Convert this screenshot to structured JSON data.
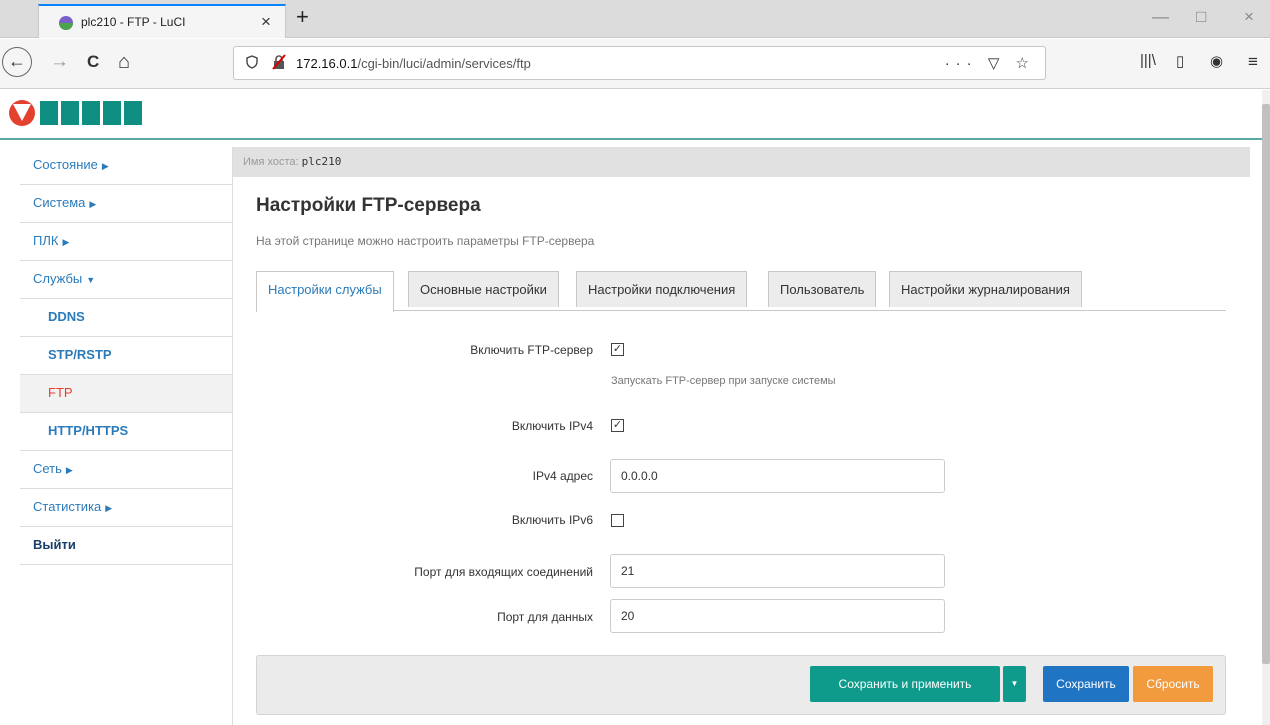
{
  "browser": {
    "tab_title": "plc210 - FTP - LuCI",
    "tab_close": "×",
    "new_tab": "+",
    "url_host": "172.16.0.1",
    "url_path": "/cgi-bin/luci/admin/services/ftp",
    "url_actions": "··· ▽ ☆",
    "icons": {
      "back": "←",
      "forward": "→",
      "reload": "C",
      "home": "⌂",
      "library": "|||\\",
      "sidebar": "▯",
      "account": "◉",
      "menu": "≡",
      "minimize": "—",
      "maximize": "□",
      "close": "×"
    }
  },
  "colors": {
    "accent": "#0e9b8c",
    "link": "#2b7bba",
    "active": "#e4402e",
    "save": "#1f74c4",
    "reset": "#f19a3e",
    "logo_red": "#e4402e",
    "logo_green": "#0e8f82"
  },
  "sidebar": {
    "items": [
      {
        "label": "Состояние",
        "caret": "▶"
      },
      {
        "label": "Система",
        "caret": "▶"
      },
      {
        "label": "ПЛК",
        "caret": "▶"
      },
      {
        "label": "Службы",
        "caret": "▼"
      },
      {
        "label": "DDNS"
      },
      {
        "label": "STP/RSTP"
      },
      {
        "label": "FTP"
      },
      {
        "label": "HTTP/HTTPS"
      },
      {
        "label": "Сеть",
        "caret": "▶"
      },
      {
        "label": "Статистика",
        "caret": "▶"
      },
      {
        "label": "Выйти"
      }
    ]
  },
  "hostbar": {
    "label": "Имя хоста:",
    "value": "plc210"
  },
  "main": {
    "title": "Настройки FTP-сервера",
    "description": "На этой странице можно настроить параметры FTP-сервера",
    "tabs": [
      {
        "label": "Настройки службы"
      },
      {
        "label": "Основные настройки"
      },
      {
        "label": "Настройки подключения"
      },
      {
        "label": "Пользователь"
      },
      {
        "label": "Настройки журналирования"
      }
    ],
    "fields": {
      "enable_ftp": {
        "label": "Включить FTP-сервер",
        "checked": "✓",
        "hint": "Запускать FTP-сервер при запуске системы"
      },
      "enable_ipv4": {
        "label": "Включить IPv4",
        "checked": "✓"
      },
      "ipv4_address": {
        "label": "IPv4 адрес",
        "value": "0.0.0.0"
      },
      "enable_ipv6": {
        "label": "Включить IPv6",
        "checked": ""
      },
      "incoming_port": {
        "label": "Порт для входящих соединений",
        "value": "21"
      },
      "data_port": {
        "label": "Порт для данных",
        "value": "20"
      }
    }
  },
  "actions": {
    "save_apply": "Сохранить и применить",
    "dropdown": "▼",
    "save": "Сохранить",
    "reset": "Сбросить"
  }
}
